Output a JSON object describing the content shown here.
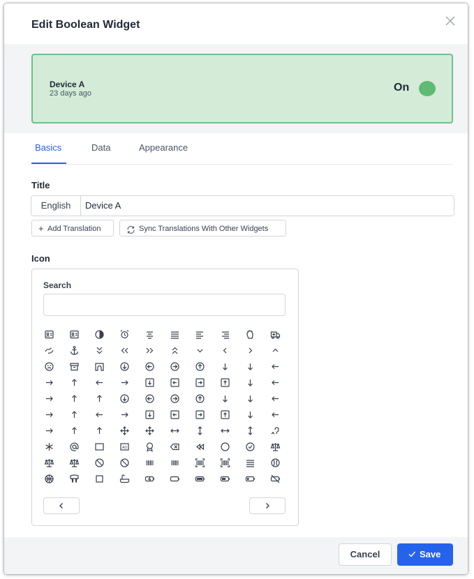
{
  "dialog": {
    "title": "Edit Boolean Widget"
  },
  "preview": {
    "device_name": "Device A",
    "time_ago": "23 days ago",
    "state_label": "On",
    "toggle_color": "#5fba74",
    "bg_color": "#d4ebd8",
    "border_color": "#6cc285"
  },
  "tabs": [
    {
      "label": "Basics",
      "active": true
    },
    {
      "label": "Data",
      "active": false
    },
    {
      "label": "Appearance",
      "active": false
    }
  ],
  "title_section": {
    "label": "Title",
    "language": "English",
    "value": "Device A",
    "add_translation": "Add Translation",
    "sync_translations": "Sync Translations With Other Widgets"
  },
  "icon_section": {
    "label": "Icon",
    "search_label": "Search",
    "search_value": "",
    "icons": [
      [
        "address-book-icon",
        "id-card-icon",
        "contrast-icon",
        "alarm-clock-icon",
        "align-center-icon",
        "align-justify-icon",
        "align-left-icon",
        "align-right-icon",
        "hand-stop-icon",
        "ambulance-icon"
      ],
      [
        "american-sign-language-icon",
        "anchor-icon",
        "chevrons-down-icon",
        "chevrons-left-icon",
        "chevrons-right-icon",
        "chevrons-up-icon",
        "chevron-down-icon",
        "chevron-left-icon",
        "chevron-right-icon",
        "chevron-up-icon"
      ],
      [
        "angry-face-icon",
        "archive-icon",
        "archway-icon",
        "arrow-circle-down-icon",
        "arrow-circle-left-icon",
        "arrow-circle-right-icon",
        "arrow-circle-up-icon",
        "arrow-alt-down-icon",
        "arrow-alt-from-bottom-icon",
        "arrow-alt-from-left-icon"
      ],
      [
        "arrow-alt-from-right-icon",
        "arrow-alt-from-top-icon",
        "arrow-alt-left-icon",
        "arrow-alt-right-icon",
        "arrow-square-down-icon",
        "arrow-square-left-icon",
        "arrow-square-right-icon",
        "arrow-square-up-icon",
        "arrow-alt-to-bottom-icon",
        "arrow-alt-to-left-icon"
      ],
      [
        "arrow-alt-to-right-icon",
        "arrow-alt-to-top-icon",
        "arrow-alt-up-icon",
        "arrow-circle-down-thin-icon",
        "arrow-circle-left-thin-icon",
        "arrow-circle-right-thin-icon",
        "arrow-circle-up-thin-icon",
        "arrow-down-icon",
        "arrow-from-bottom-icon",
        "arrow-from-left-icon"
      ],
      [
        "arrow-from-right-icon",
        "arrow-from-top-icon",
        "arrow-left-icon",
        "arrow-right-icon",
        "arrow-square-down-thin-icon",
        "arrow-square-left-thin-icon",
        "arrow-square-right-thin-icon",
        "arrow-square-up-thin-icon",
        "arrow-to-bottom-icon",
        "arrow-to-left-icon"
      ],
      [
        "arrow-to-right-icon",
        "arrow-to-top-icon",
        "arrow-up-icon",
        "arrows-icon",
        "arrows-alt-icon",
        "arrows-h-icon",
        "arrows-v-icon",
        "arrows-alt-h-icon",
        "arrows-alt-v-icon",
        "assistive-listening-icon"
      ],
      [
        "asterisk-icon",
        "at-icon",
        "award-icon",
        "ad-icon",
        "award-ribbon-icon",
        "backspace-icon",
        "backward-icon",
        "badge-icon",
        "badge-check-icon",
        "balance-scale-icon"
      ],
      [
        "balance-scale-left-icon",
        "balance-scale-right-icon",
        "ban-icon",
        "band-aid-icon",
        "barcode-icon",
        "barcode-alt-icon",
        "barcode-read-icon",
        "barcode-scan-icon",
        "bars-icon",
        "baseball-icon"
      ],
      [
        "basketball-ball-icon",
        "basketball-hoop-icon",
        "basketball-icon",
        "bath-icon",
        "battery-bolt-icon",
        "battery-empty-icon",
        "battery-full-icon",
        "battery-half-icon",
        "battery-quarter-icon",
        "battery-slash-icon"
      ]
    ],
    "prev_icon": "chevron-left-icon",
    "next_icon": "chevron-right-icon"
  },
  "footer": {
    "cancel_label": "Cancel",
    "save_label": "Save",
    "save_color": "#2563eb"
  }
}
